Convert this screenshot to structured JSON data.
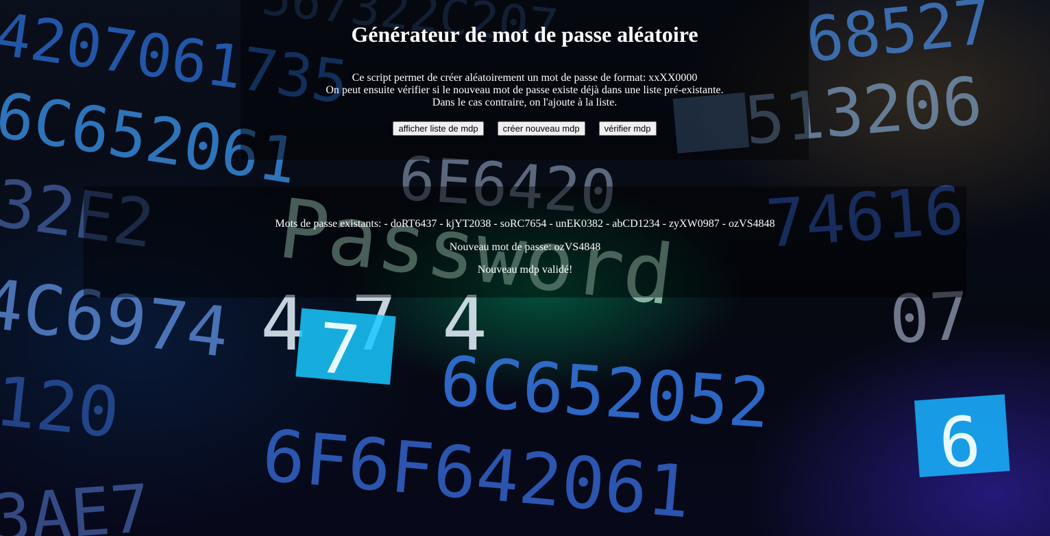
{
  "header": {
    "title": "Générateur de mot de passe aléatoire",
    "description_lines": [
      "Ce script permet de créer aléatoirement un mot de passe de format: xxXX0000",
      "On peut ensuite vérifier si le nouveau mot de passe existe déjà dans une liste pré-existante.",
      "Dans le cas contraire, on l'ajoute à la liste."
    ]
  },
  "buttons": {
    "show_list": "afficher liste de mdp",
    "create_new": "créer nouveau mdp",
    "verify": "vérifier mdp"
  },
  "result": {
    "existing_passwords": "Mots de passe existants: - doRT6437 - kjYT2038 - soRC7654 - unEK0382 - abCD1234 - zyXW0987 - ozVS4848",
    "new_password": "Nouveau mot de passe: ozVS4848",
    "status": "Nouveau mdp validé!"
  },
  "background": {
    "description_word": "Password",
    "accent_colors": [
      "#2fb8ff",
      "#00e38a",
      "#1a3cff"
    ]
  }
}
